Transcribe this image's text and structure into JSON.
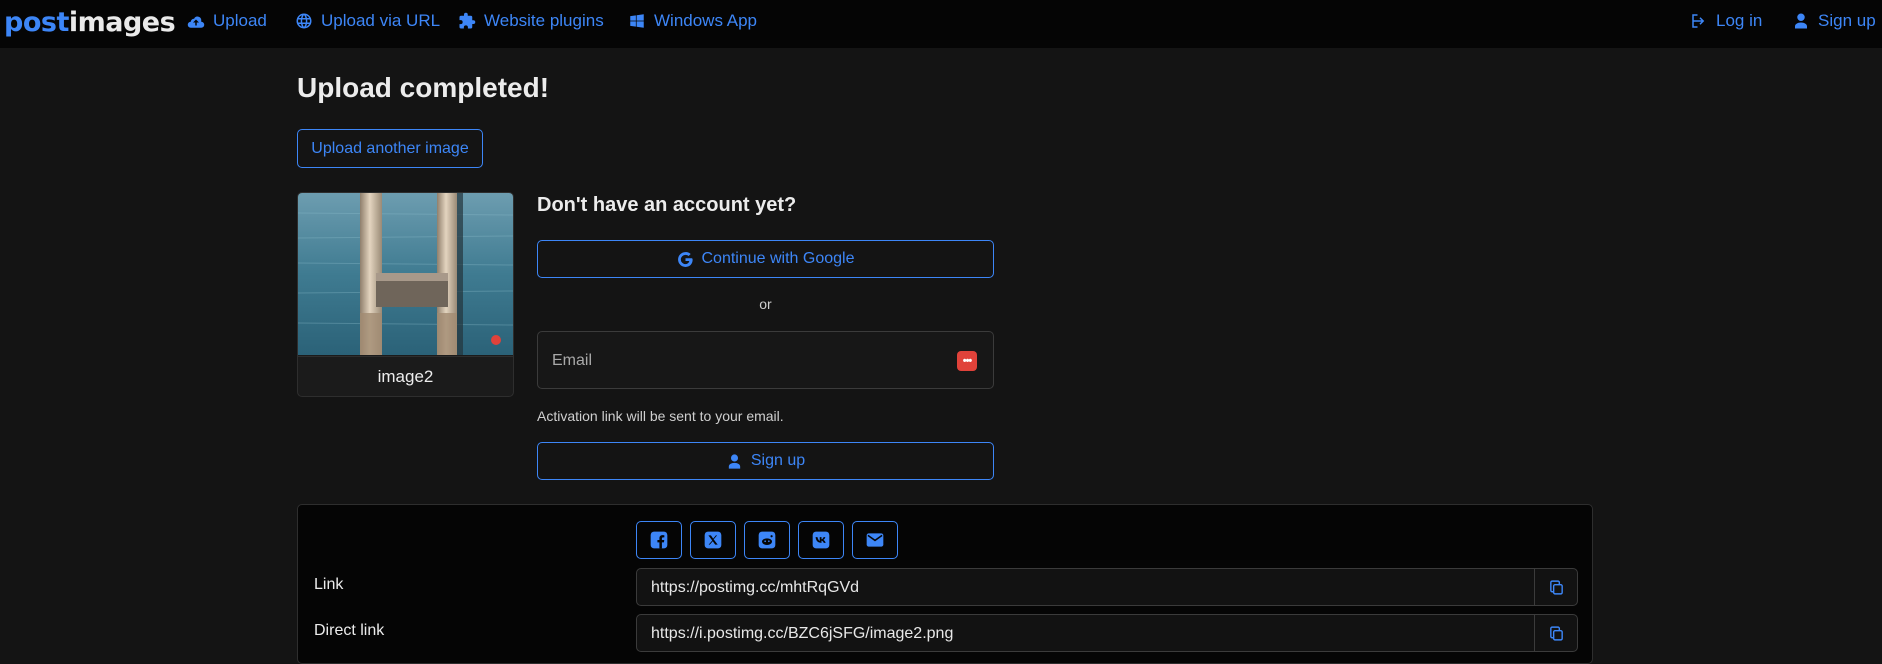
{
  "nav": {
    "brand_part1": "post",
    "brand_part2": "images",
    "upload": "Upload",
    "upload_url": "Upload via URL",
    "plugins": "Website plugins",
    "windows_app": "Windows App",
    "login": "Log in",
    "signup": "Sign up"
  },
  "main": {
    "title": "Upload completed!",
    "upload_another": "Upload another image",
    "image_name": "image2"
  },
  "account": {
    "title": "Don't have an account yet?",
    "google_button": "Continue with Google",
    "or": "or",
    "email_placeholder": "Email",
    "activation_note": "Activation link will be sent to your email.",
    "signup_button": "Sign up"
  },
  "share": {
    "social": [
      "facebook",
      "x",
      "reddit",
      "vk",
      "email"
    ],
    "rows": [
      {
        "label": "Link",
        "value": "https://postimg.cc/mhtRqGVd"
      },
      {
        "label": "Direct link",
        "value": "https://i.postimg.cc/BZC6jSFG/image2.png"
      }
    ]
  },
  "colors": {
    "accent": "#3d86f7",
    "background": "#141414",
    "navbar": "#050505",
    "password_badge": "#e0423a"
  }
}
